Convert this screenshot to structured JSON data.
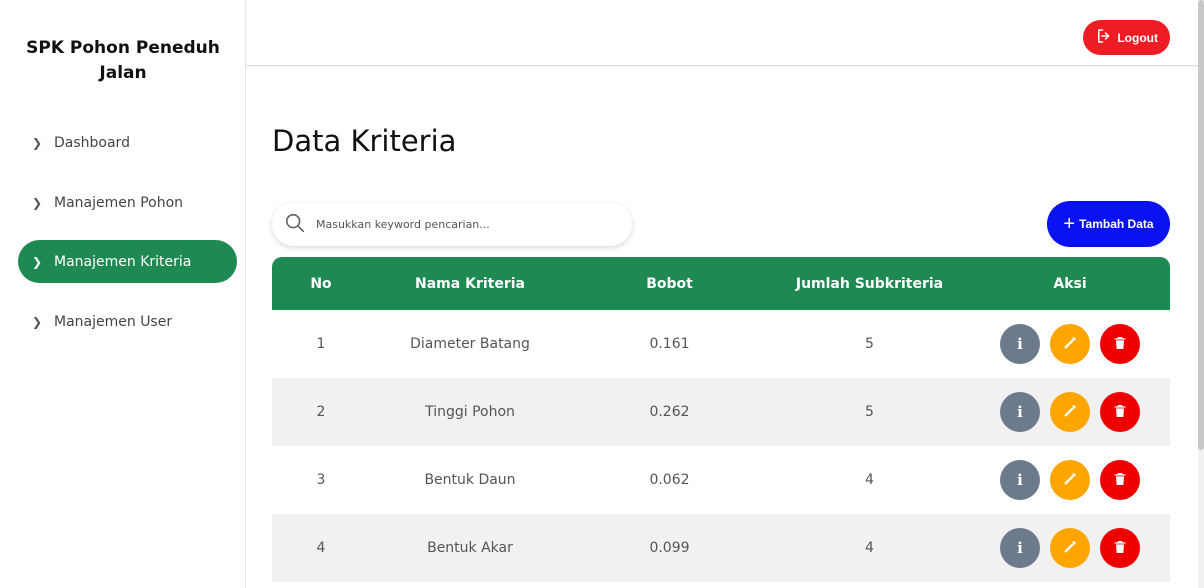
{
  "sidebar": {
    "brand": "SPK Pohon Peneduh Jalan",
    "items": [
      {
        "label": "Dashboard",
        "active": false
      },
      {
        "label": "Manajemen Pohon",
        "active": false
      },
      {
        "label": "Manajemen Kriteria",
        "active": true
      },
      {
        "label": "Manajemen User",
        "active": false
      }
    ]
  },
  "topbar": {
    "logout_label": "Logout"
  },
  "main": {
    "title": "Data Kriteria",
    "search_placeholder": "Masukkan keyword pencarian...",
    "add_label": "Tambah Data",
    "table": {
      "headers": [
        "No",
        "Nama Kriteria",
        "Bobot",
        "Jumlah Subkriteria",
        "Aksi"
      ],
      "rows": [
        {
          "no": "1",
          "nama": "Diameter Batang",
          "bobot": "0.161",
          "jumlah": "5"
        },
        {
          "no": "2",
          "nama": "Tinggi Pohon",
          "bobot": "0.262",
          "jumlah": "5"
        },
        {
          "no": "3",
          "nama": "Bentuk Daun",
          "bobot": "0.062",
          "jumlah": "4"
        },
        {
          "no": "4",
          "nama": "Bentuk Akar",
          "bobot": "0.099",
          "jumlah": "4"
        }
      ]
    },
    "info_glyph": "i"
  },
  "colors": {
    "primary_green": "#1e8a52",
    "logout_red": "#ee1c24",
    "add_blue": "#0b12f2",
    "info_gray": "#6c7b8b",
    "edit_orange": "#ffa500",
    "delete_red": "#ee0000"
  },
  "icons": {
    "nav": "chevron-right-icon",
    "logout": "logout-icon",
    "search": "search-icon",
    "add": "plus-icon",
    "info": "info-icon",
    "edit": "pencil-icon",
    "delete": "trash-icon"
  }
}
